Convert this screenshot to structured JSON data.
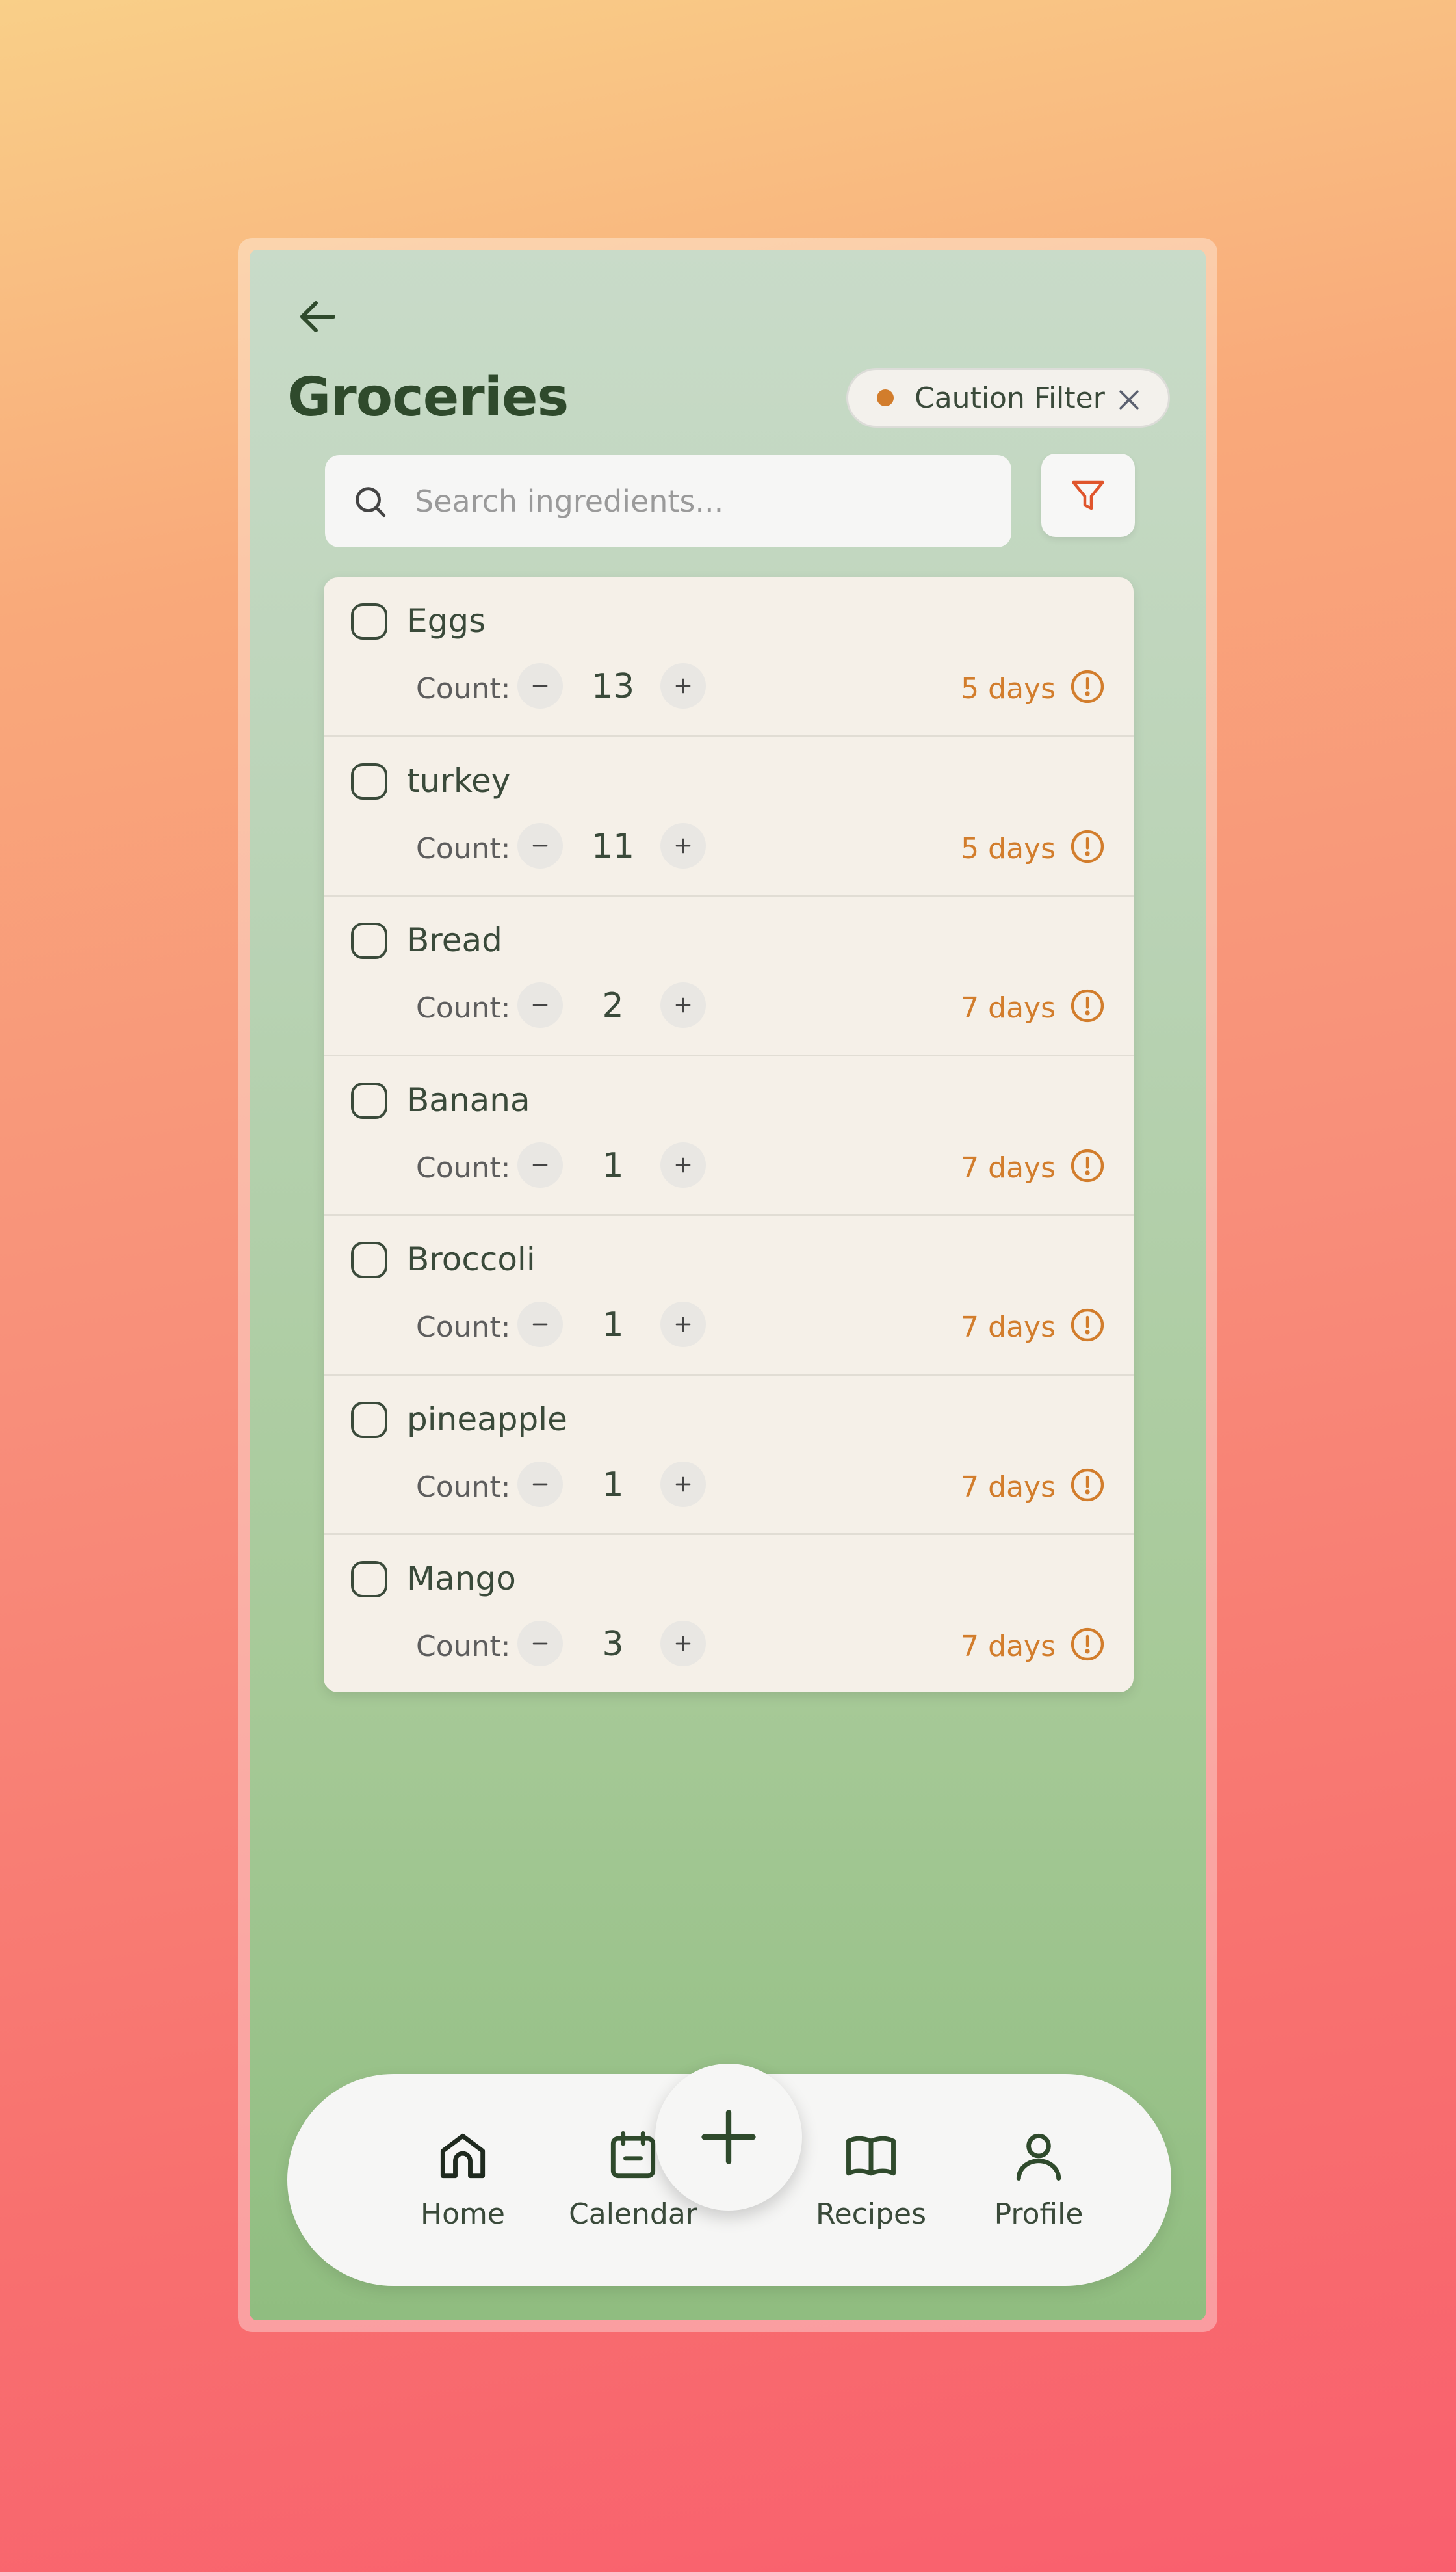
{
  "header": {
    "title": "Groceries",
    "back_icon": "arrow-left-icon"
  },
  "filter_chip": {
    "label": "Caution Filter",
    "dot_color": "#d27d2c"
  },
  "search": {
    "placeholder": "Search ingredients...",
    "value": ""
  },
  "items": [
    {
      "name": "Eggs",
      "count_label": "Count:",
      "count": "13",
      "days": "5 days"
    },
    {
      "name": "turkey",
      "count_label": "Count:",
      "count": "11",
      "days": "5 days"
    },
    {
      "name": "Bread",
      "count_label": "Count:",
      "count": "2",
      "days": "7 days"
    },
    {
      "name": "Banana",
      "count_label": "Count:",
      "count": "1",
      "days": "7 days"
    },
    {
      "name": "Broccoli",
      "count_label": "Count:",
      "count": "1",
      "days": "7 days"
    },
    {
      "name": "pineapple",
      "count_label": "Count:",
      "count": "1",
      "days": "7 days"
    },
    {
      "name": "Mango",
      "count_label": "Count:",
      "count": "3",
      "days": "7 days"
    }
  ],
  "nav": {
    "items": [
      {
        "label": "Home",
        "icon": "home-icon"
      },
      {
        "label": "Calendar",
        "icon": "calendar-icon"
      },
      {
        "label": "Recipes",
        "icon": "book-icon"
      },
      {
        "label": "Profile",
        "icon": "user-icon"
      }
    ],
    "fab_icon": "plus-icon"
  },
  "colors": {
    "accent": "#d27d2c",
    "text_dark": "#2f4a2c",
    "card_bg": "#f5f0e8"
  }
}
